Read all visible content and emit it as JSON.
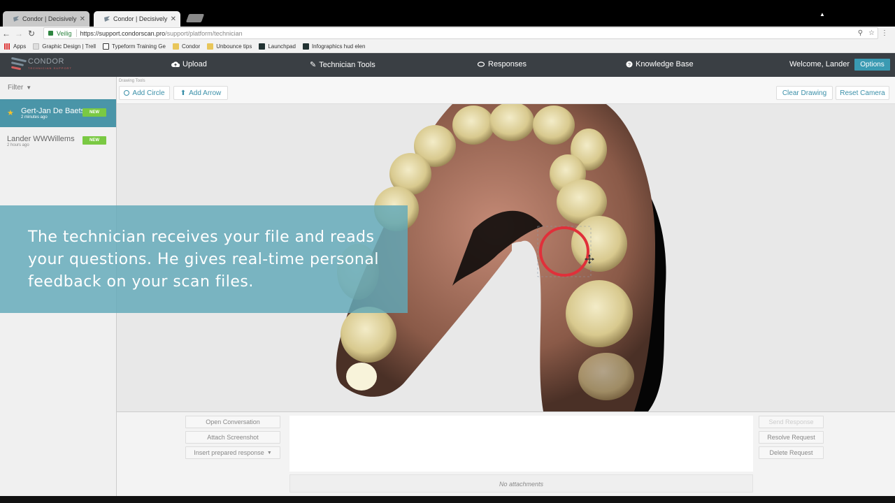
{
  "browser": {
    "tabs": [
      {
        "title": "Condor | Decisively Diffe",
        "close": "✕"
      },
      {
        "title": "Condor | Decisively Diffe",
        "close": "✕"
      }
    ],
    "secure_label": "Veilig",
    "url_host": "https://support.condorscan.pro",
    "url_path": "/support/platform/technician",
    "bookmarks": [
      {
        "label": "Apps",
        "icon": "apps-icon"
      },
      {
        "label": "Graphic Design | Trell",
        "icon": "doc-icon"
      },
      {
        "label": "Typeform Training Ge",
        "icon": "typeform-icon"
      },
      {
        "label": "Condor",
        "icon": "folder-icon"
      },
      {
        "label": "Unbounce tips",
        "icon": "folder-icon"
      },
      {
        "label": "Launchpad",
        "icon": "launchpad-icon"
      },
      {
        "label": "Infographics hud elen",
        "icon": "infographics-icon"
      }
    ]
  },
  "app": {
    "logo_text": "CONDOR",
    "logo_tagline": "TECHNICIAN SUPPORT",
    "nav": [
      {
        "label": "Upload",
        "icon": "cloud-upload-icon"
      },
      {
        "label": "Technician Tools",
        "icon": "pencil-icon"
      },
      {
        "label": "Responses",
        "icon": "comments-icon"
      },
      {
        "label": "Knowledge Base",
        "icon": "question-circle-icon"
      }
    ],
    "welcome": "Welcome, Lander",
    "options": "Options"
  },
  "sidebar": {
    "filter": "Filter",
    "tickets": [
      {
        "name": "Gert-Jan De Baets",
        "time": "2 minutes ago",
        "badge": "NEW",
        "starred": true
      },
      {
        "name": "Lander WWWillems",
        "time": "2 hours ago",
        "badge": "NEW",
        "starred": false
      }
    ]
  },
  "toolbar": {
    "label": "Drawing Tools",
    "add_circle": "Add Circle",
    "add_arrow": "Add Arrow",
    "clear_drawing": "Clear Drawing",
    "reset_camera": "Reset Camera"
  },
  "bottom": {
    "open_conversation": "Open Conversation",
    "attach_screenshot": "Attach Screenshot",
    "insert_prepared": "Insert prepared response",
    "send_response": "Send Response",
    "resolve_request": "Resolve Request",
    "delete_request": "Delete Request",
    "no_attachments": "No attachments"
  },
  "overlay": {
    "caption": "The technician receives your file and reads your questions. He gives real-time personal feedback on your scan files."
  },
  "colors": {
    "header": "#3a3f44",
    "accent": "#3a9ab2",
    "badge_green": "#7ac943",
    "selected_ticket": "#4a95a8",
    "annotation_red": "#e0303a"
  }
}
